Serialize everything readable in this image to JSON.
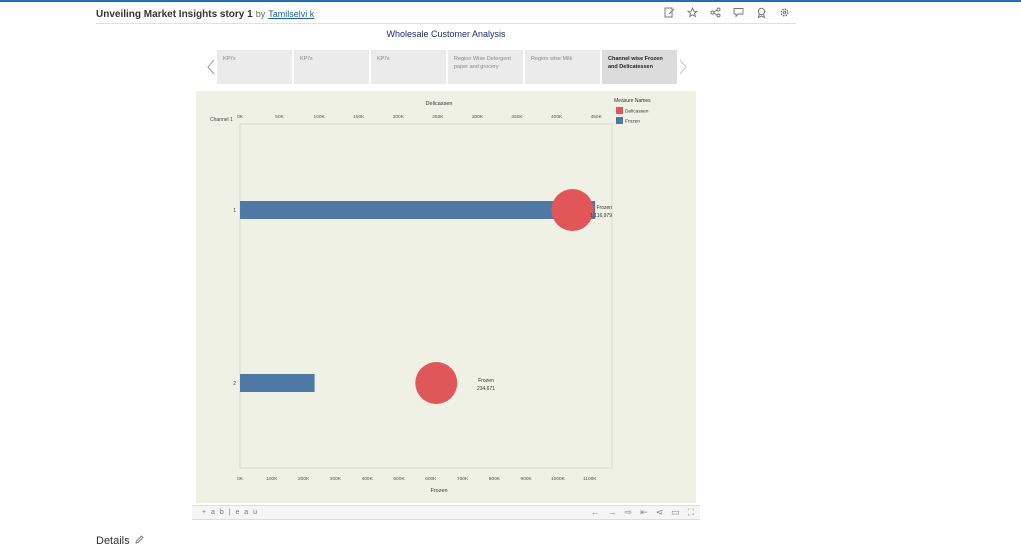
{
  "header": {
    "title": "Unveiling Market Insights story 1",
    "by": "by",
    "author": "Tamilselvi k",
    "toolbar_icons": [
      "edit-icon",
      "star-icon",
      "share-icon",
      "comment-icon",
      "badge-icon",
      "settings-icon"
    ]
  },
  "story": {
    "title": "Wholesale Customer Analysis",
    "tabs": [
      {
        "label": "KPI's",
        "active": false
      },
      {
        "label": "KPI's",
        "active": false
      },
      {
        "label": "KPI's",
        "active": false
      },
      {
        "label": "Region Wise Detergent paper and grocery",
        "active": false
      },
      {
        "label": "Region wise Milk",
        "active": false
      },
      {
        "label": "Channel wise Frozen and Delicatessen",
        "active": true
      }
    ]
  },
  "chart_data": {
    "type": "bar",
    "row_header": "Channel 1",
    "categories": [
      "1",
      "2"
    ],
    "top_axis": {
      "label": "Delicassen",
      "ticks": [
        "0K",
        "50K",
        "100K",
        "150K",
        "200K",
        "250K",
        "300K",
        "350K",
        "400K",
        "450K"
      ],
      "range": [
        0,
        470000
      ]
    },
    "bottom_axis": {
      "label": "Frozen",
      "ticks": [
        "0K",
        "100K",
        "200K",
        "300K",
        "400K",
        "500K",
        "600K",
        "700K",
        "800K",
        "900K",
        "1000K",
        "1100K"
      ],
      "range": [
        0,
        1170000
      ]
    },
    "series": [
      {
        "name": "Delicassen",
        "mark": "circle",
        "color": "#e15759",
        "values": [
          420000,
          248000
        ]
      },
      {
        "name": "Frozen",
        "mark": "bar",
        "color": "#4e79a7",
        "values": [
          1116979,
          234671
        ]
      }
    ],
    "labels": [
      {
        "title": "Frozen",
        "value": "1,116,979"
      },
      {
        "title": "Frozen",
        "value": "234,671"
      }
    ],
    "legend": {
      "title": "Measure Names",
      "position": "top-right"
    }
  },
  "bottom_bar": {
    "logo": "+ a b | e a u",
    "icons": [
      "undo-icon",
      "redo-icon",
      "revert-icon",
      "reset-icon",
      "share-icon",
      "comment-icon",
      "fullscreen-icon"
    ]
  },
  "footer": {
    "details": "Details"
  }
}
